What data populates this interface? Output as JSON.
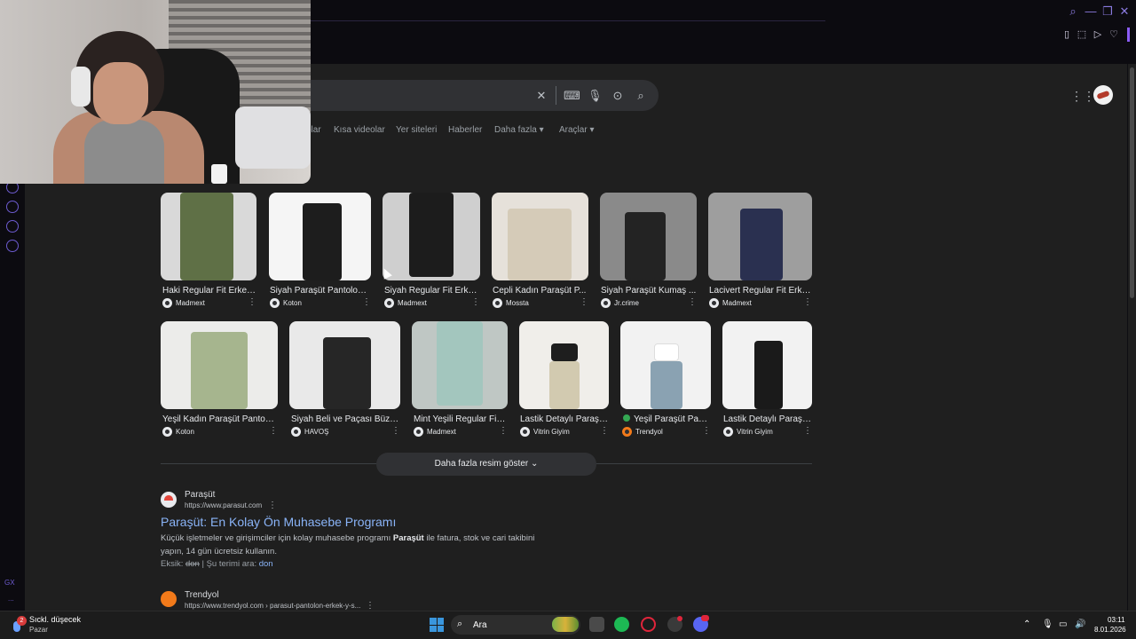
{
  "search": {
    "value": "",
    "placeholder": ""
  },
  "nav_tabs": [
    "olar",
    "Kısa videolar",
    "Yer siteleri",
    "Haberler",
    "Daha fazla",
    "Araçlar"
  ],
  "images_row1": [
    {
      "title": "Haki Regular Fit Erkek ...",
      "source": "Madmext"
    },
    {
      "title": "Siyah Paraşüt Pantolon ...",
      "source": "Koton"
    },
    {
      "title": "Siyah Regular Fit Erke...",
      "source": "Madmext"
    },
    {
      "title": "Cepli Kadın Paraşüt P...",
      "source": "Mossta"
    },
    {
      "title": "Siyah Paraşüt Kumaş ...",
      "source": "Jr.crime"
    },
    {
      "title": "Lacivert Regular Fit Erke...",
      "source": "Madmext"
    }
  ],
  "images_row2": [
    {
      "title": "Yeşil Kadın Paraşüt Pantolo...",
      "source": "Koton"
    },
    {
      "title": "Siyah Beli ve Paçası Büzg...",
      "source": "HAVOŞ"
    },
    {
      "title": "Mint Yeşili Regular Fit ...",
      "source": "Madmext"
    },
    {
      "title": "Lastik Detaylı Paraşü...",
      "source": "Vitrin Giyim"
    },
    {
      "title": "Yeşil Paraşüt Pan...",
      "source": "Trendyol"
    },
    {
      "title": "Lastik Detaylı Paraşü...",
      "source": "Vitrin Giyim"
    }
  ],
  "more_images": "Daha fazla resim göster",
  "result1": {
    "site": "Paraşüt",
    "url": "https://www.parasut.com",
    "title": "Paraşüt: En Kolay Ön Muhasebe Programı",
    "snippet_a": "Küçük işletmeler ve girişimciler için kolay muhasebe programı ",
    "snippet_bold": "Paraşüt",
    "snippet_b": " ile fatura, stok ve cari takibini yapın, 14 gün ücretsiz kullanın.",
    "missing_label": "Eksik: ",
    "missing_word": "don",
    "search_term_label": " | Şu terimi ara: ",
    "search_term": "don"
  },
  "result2": {
    "site": "Trendyol",
    "url": "https://www.trendyol.com › parasut-pantolon-erkek-y-s..."
  },
  "taskbar": {
    "weather_line1": "Sıckl. düşecek",
    "weather_line2": "Pazar",
    "weather_badge": "2",
    "search_label": "Ara",
    "time": "03:11",
    "date": "8.01.2026"
  },
  "sidebar": {
    "gx_label": "GX",
    "dots": "..."
  },
  "colors": {
    "accent": "#8b5cf6",
    "link": "#8ab4f8",
    "page_bg": "#1f1f1f"
  }
}
